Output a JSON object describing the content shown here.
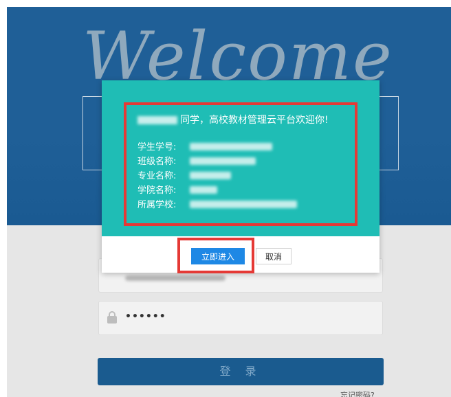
{
  "background": {
    "welcome_text": "Welcome",
    "password_mask": "••••••",
    "login_button": "登 录",
    "forgot_link": "忘记密码?"
  },
  "modal": {
    "greeting": "同学，高校教材管理云平台欢迎你!",
    "fields": [
      {
        "label": "学生学号:"
      },
      {
        "label": "班级名称:"
      },
      {
        "label": "专业名称:"
      },
      {
        "label": "学院名称:"
      },
      {
        "label": "所属学校:"
      }
    ],
    "enter_button": "立即进入",
    "cancel_button": "取消"
  },
  "colors": {
    "header_blue": "#1f5f97",
    "modal_teal": "#1fbdb5",
    "highlight_red": "#e53935",
    "primary_button": "#1e88e5",
    "login_button": "#1a5b8f"
  }
}
